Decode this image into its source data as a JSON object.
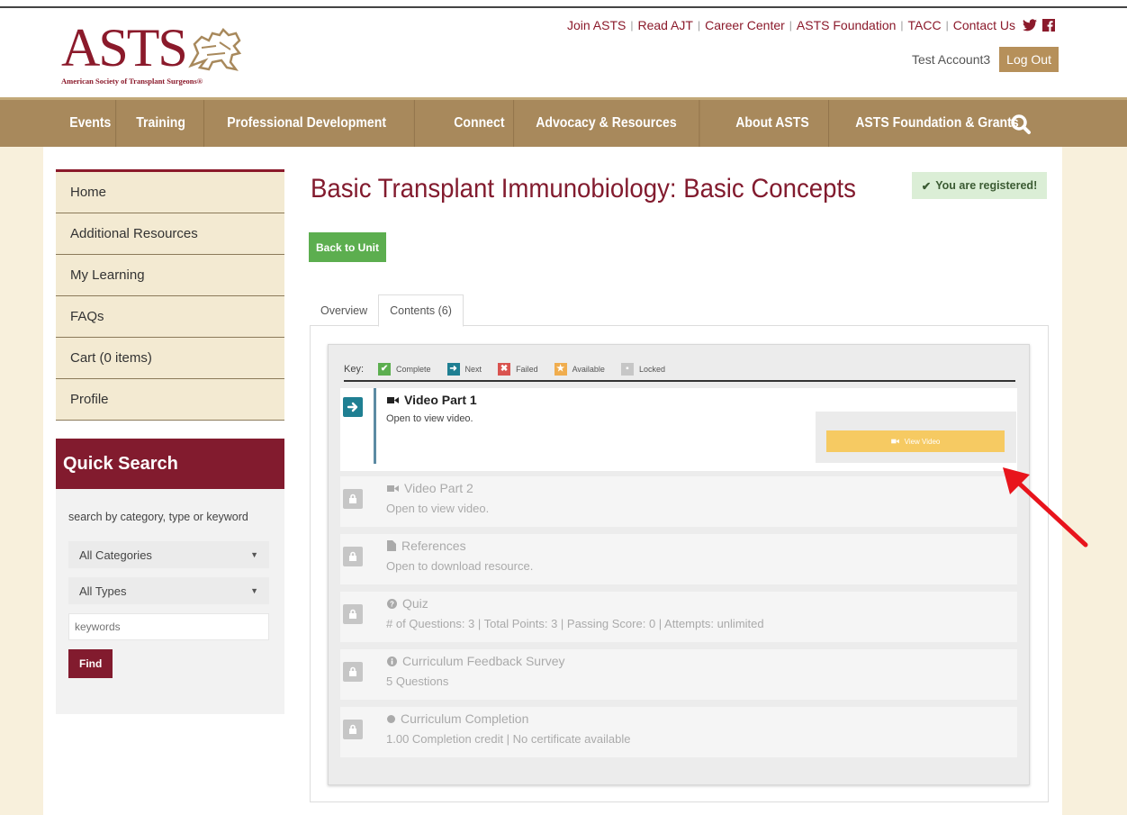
{
  "header": {
    "logo_word": "ASTS",
    "logo_sub": "American Society of Transplant Surgeons®",
    "top_links": [
      "Join ASTS",
      "Read AJT",
      "Career Center",
      "ASTS Foundation",
      "TACC",
      "Contact Us"
    ],
    "username": "Test Account3",
    "logout_label": "Log Out",
    "social": [
      "twitter-icon",
      "facebook-icon"
    ]
  },
  "nav": {
    "items": [
      "Events",
      "Training",
      "Professional Development",
      "Connect",
      "Advocacy & Resources",
      "About ASTS",
      "ASTS Foundation & Grants"
    ]
  },
  "sidebar": {
    "items": [
      "Home",
      "Additional Resources",
      "My Learning",
      "FAQs",
      "Cart (0 items)",
      "Profile"
    ]
  },
  "quick_search": {
    "title": "Quick Search",
    "hint": "search by category, type or keyword",
    "category_value": "All Categories",
    "type_value": "All Types",
    "keywords_placeholder": "keywords",
    "find_label": "Find"
  },
  "main": {
    "title": "Basic Transplant Immunobiology: Basic Concepts",
    "registered": "You are registered!",
    "back_label": "Back to Unit",
    "tabs": [
      "Overview",
      "Contents (6)"
    ],
    "active_tab": "Contents (6)"
  },
  "key": {
    "label": "Key:",
    "entries": [
      {
        "label": "Complete",
        "color": "#5cae4f",
        "icon": "check-icon"
      },
      {
        "label": "Next",
        "color": "#1f7f92",
        "icon": "arrow-right-icon"
      },
      {
        "label": "Failed",
        "color": "#d9534f",
        "icon": "x-icon"
      },
      {
        "label": "Available",
        "color": "#f0ad4e",
        "icon": "star-icon"
      },
      {
        "label": "Locked",
        "color": "#c6c6c6",
        "icon": "lock-icon"
      }
    ]
  },
  "items": [
    {
      "title": "Video Part 1",
      "desc": "Open to view video.",
      "icon": "video-icon",
      "status": "next",
      "action": "View Video"
    },
    {
      "title": "Video Part 2",
      "desc": "Open to view video.",
      "icon": "video-icon",
      "status": "locked"
    },
    {
      "title": "References",
      "desc": "Open to download resource.",
      "icon": "file-icon",
      "status": "locked"
    },
    {
      "title": "Quiz",
      "desc": "# of Questions: 3 | Total Points: 3 | Passing Score:  0 | Attempts: unlimited",
      "icon": "question-icon",
      "status": "locked"
    },
    {
      "title": "Curriculum Feedback Survey",
      "desc": "5 Questions",
      "icon": "info-icon",
      "status": "locked"
    },
    {
      "title": "Curriculum Completion",
      "desc": "1.00 Completion credit  |  No certificate available",
      "icon": "circle-icon",
      "status": "locked"
    }
  ],
  "colors": {
    "brand": "#821b2e",
    "nav": "#a8895c",
    "accent_green": "#5cae4f",
    "next_teal": "#1f7f92",
    "view_button": "#f6ca62"
  }
}
